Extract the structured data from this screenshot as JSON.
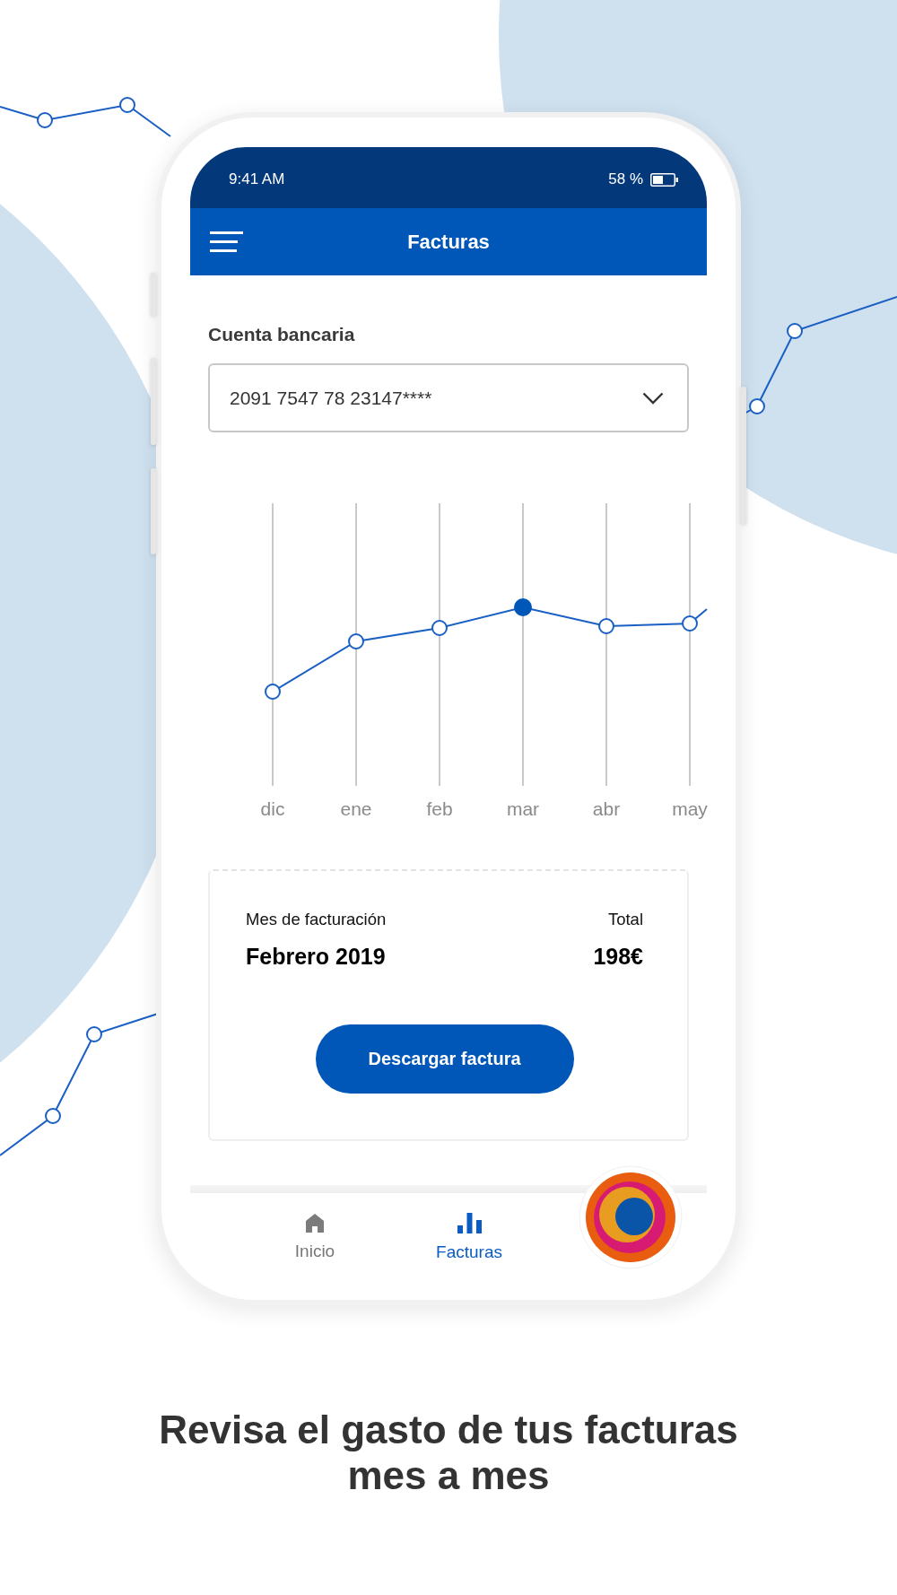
{
  "status_bar": {
    "time": "9:41 AM",
    "battery": "58 %"
  },
  "header": {
    "title": "Facturas"
  },
  "account": {
    "label": "Cuenta bancaria",
    "value": "2091 7547 78 23147****"
  },
  "chart": {
    "months": [
      {
        "label": "dic",
        "selected": false
      },
      {
        "label": "ene",
        "selected": false
      },
      {
        "label": "feb",
        "selected": false
      },
      {
        "label": "mar",
        "selected": true
      },
      {
        "label": "abr",
        "selected": false
      },
      {
        "label": "may",
        "selected": false
      }
    ]
  },
  "invoice": {
    "month_label": "Mes de facturación",
    "month": "Febrero 2019",
    "total_label": "Total",
    "total": "198€",
    "button": "Descargar factura"
  },
  "bottom_nav": [
    {
      "kind": "home",
      "label": "Inicio",
      "selected": false
    },
    {
      "kind": "bills",
      "label": "Facturas",
      "selected": true
    }
  ],
  "caption": "Revisa el gasto de tus facturas\nmes a mes"
}
